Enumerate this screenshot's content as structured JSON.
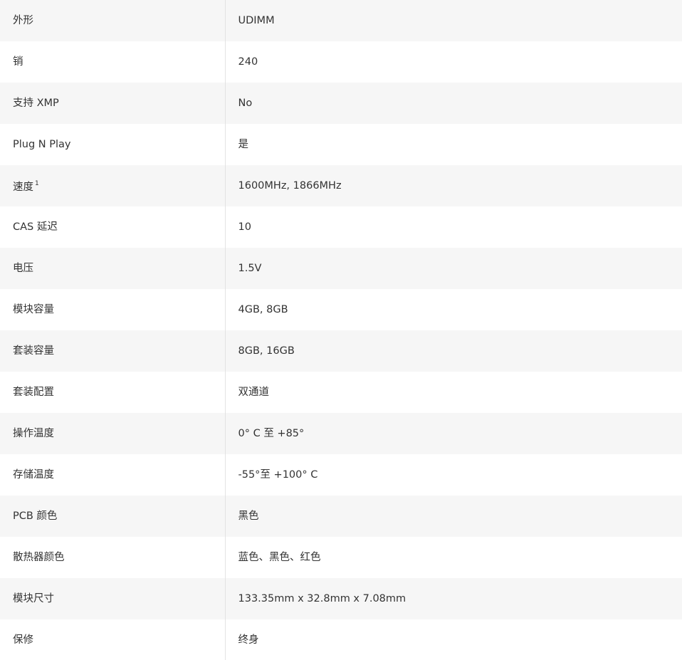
{
  "specs": [
    {
      "label": "外形",
      "value": "UDIMM"
    },
    {
      "label": "销",
      "value": "240"
    },
    {
      "label": "支持 XMP",
      "value": "No"
    },
    {
      "label": "Plug N Play",
      "value": "是"
    },
    {
      "label": "速度",
      "label_sup": "1",
      "value": "1600MHz, 1866MHz"
    },
    {
      "label": "CAS 延迟",
      "value": "10"
    },
    {
      "label": "电压",
      "value": "1.5V"
    },
    {
      "label": "模块容量",
      "value": "4GB, 8GB"
    },
    {
      "label": "套装容量",
      "value": "8GB, 16GB"
    },
    {
      "label": "套装配置",
      "value": "双通道"
    },
    {
      "label": "操作温度",
      "value": "0° C 至 +85°"
    },
    {
      "label": "存储温度",
      "value": "-55°至 +100° C"
    },
    {
      "label": "PCB 颜色",
      "value": "黑色"
    },
    {
      "label": "散热器颜色",
      "value": "蓝色、黑色、红色"
    },
    {
      "label": "模块尺寸",
      "value": "133.35mm x 32.8mm x 7.08mm"
    },
    {
      "label": "保修",
      "value": "终身"
    }
  ]
}
